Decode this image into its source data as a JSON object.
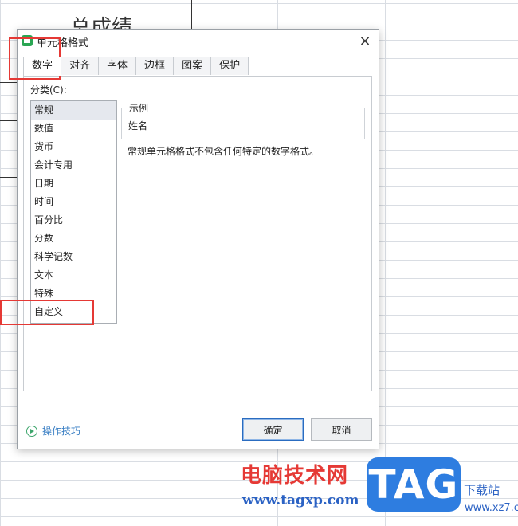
{
  "sheet": {
    "title_fragment": "总成绩"
  },
  "dialog": {
    "title": "单元格格式",
    "close_glyph": "×",
    "tabs": [
      {
        "label": "数字",
        "active": true
      },
      {
        "label": "对齐",
        "active": false
      },
      {
        "label": "字体",
        "active": false
      },
      {
        "label": "边框",
        "active": false
      },
      {
        "label": "图案",
        "active": false
      },
      {
        "label": "保护",
        "active": false
      }
    ],
    "category_label": "分类(C):",
    "categories": [
      "常规",
      "数值",
      "货币",
      "会计专用",
      "日期",
      "时间",
      "百分比",
      "分数",
      "科学记数",
      "文本",
      "特殊",
      "自定义"
    ],
    "selected_category": "常规",
    "sample_legend": "示例",
    "sample_value": "姓名",
    "description": "常规单元格格式不包含任何特定的数字格式。",
    "tips_label": "操作技巧",
    "ok_label": "确定",
    "cancel_label": "取消"
  },
  "icons": {
    "app": "spreadsheet-app-icon",
    "close": "close-icon",
    "tips": "play-circle-icon"
  },
  "colors": {
    "highlight": "#e53935",
    "link": "#3a7fc4",
    "accent_green": "#2aa653"
  },
  "watermark": {
    "cn_text": "电脑技术网",
    "url": "www.tagxp.com",
    "logo_text": "TAG",
    "cn_text2": "下载站",
    "url2": "www.xz7.com"
  }
}
